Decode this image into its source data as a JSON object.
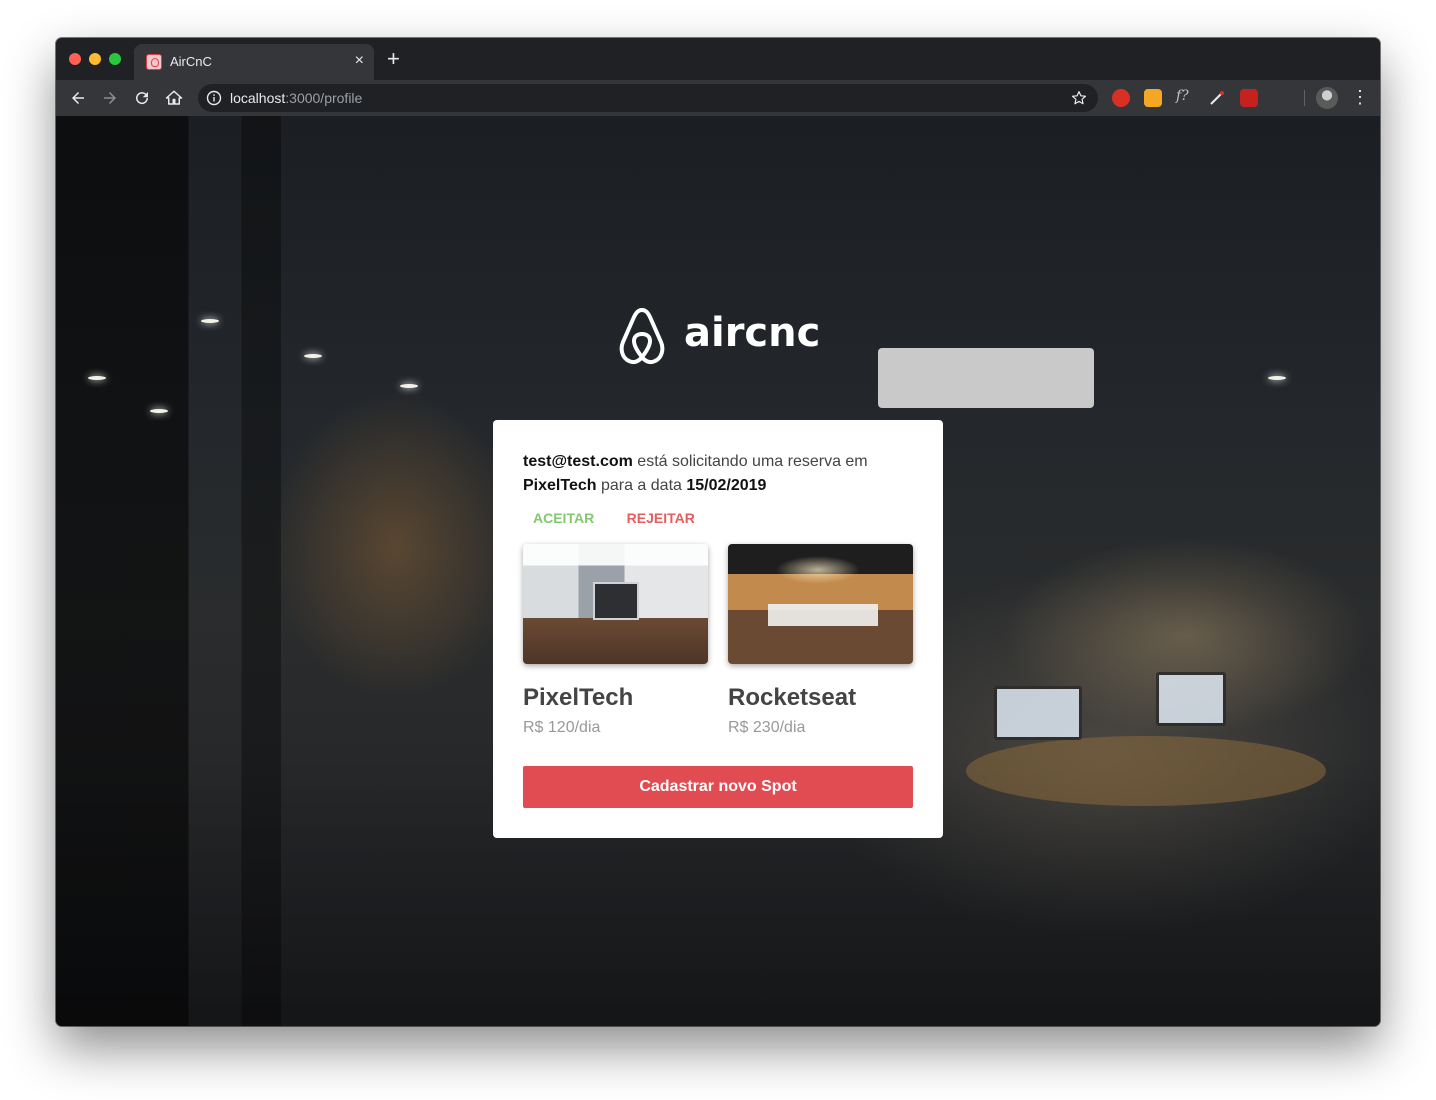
{
  "browser": {
    "tab_title": "AirCnC",
    "tab_close": "×",
    "new_tab": "+",
    "url_host": "localhost",
    "url_path": ":3000/profile",
    "menu": "⋮"
  },
  "logo": {
    "text": "aircnc"
  },
  "booking": {
    "user_email": "test@test.com",
    "text_requesting": " está solicitando uma reserva em",
    "spot_company": "PixelTech",
    "text_date_prefix": " para a data ",
    "date": "15/02/2019",
    "accept_label": "ACEITAR",
    "reject_label": "REJEITAR"
  },
  "spots": [
    {
      "company": "PixelTech",
      "price": "R$ 120/dia"
    },
    {
      "company": "Rocketseat",
      "price": "R$ 230/dia"
    }
  ],
  "new_spot_button": "Cadastrar novo Spot",
  "colors": {
    "accept": "#84c870",
    "reject": "#e55e5e",
    "primary_button": "#e14c52",
    "card_bg": "#ffffff"
  },
  "icons": [
    "back-icon",
    "forward-icon",
    "reload-icon",
    "home-icon",
    "info-icon",
    "bookmark-star-icon",
    "extension-icons",
    "profile-avatar",
    "more-menu-icon"
  ]
}
